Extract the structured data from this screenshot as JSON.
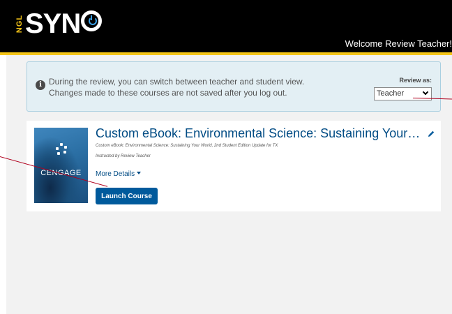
{
  "header": {
    "logo_prefix": "NGL",
    "logo_text": "SYN",
    "welcome": "Welcome Review Teacher!",
    "accent_color": "#f5c518"
  },
  "notice": {
    "line1": "During the review, you can switch between teacher and student view.",
    "line2": "Changes made to these courses are not saved after you log out.",
    "review_as_label": "Review as:",
    "review_as_value": "Teacher",
    "icon": "info-icon"
  },
  "course": {
    "cover_brand": "CENGAGE",
    "title": "Custom eBook: Environmental Science: Sustaining Your World, 2nd Student Edition Update for TX",
    "subtitle": "Custom eBook: Environmental Science: Sustaining Your World, 2nd Student Edition Update for TX",
    "instructor": "Instructed by Review Teacher",
    "more_details": "More Details",
    "launch": "Launch Course",
    "edit_icon": "pencil-icon"
  }
}
